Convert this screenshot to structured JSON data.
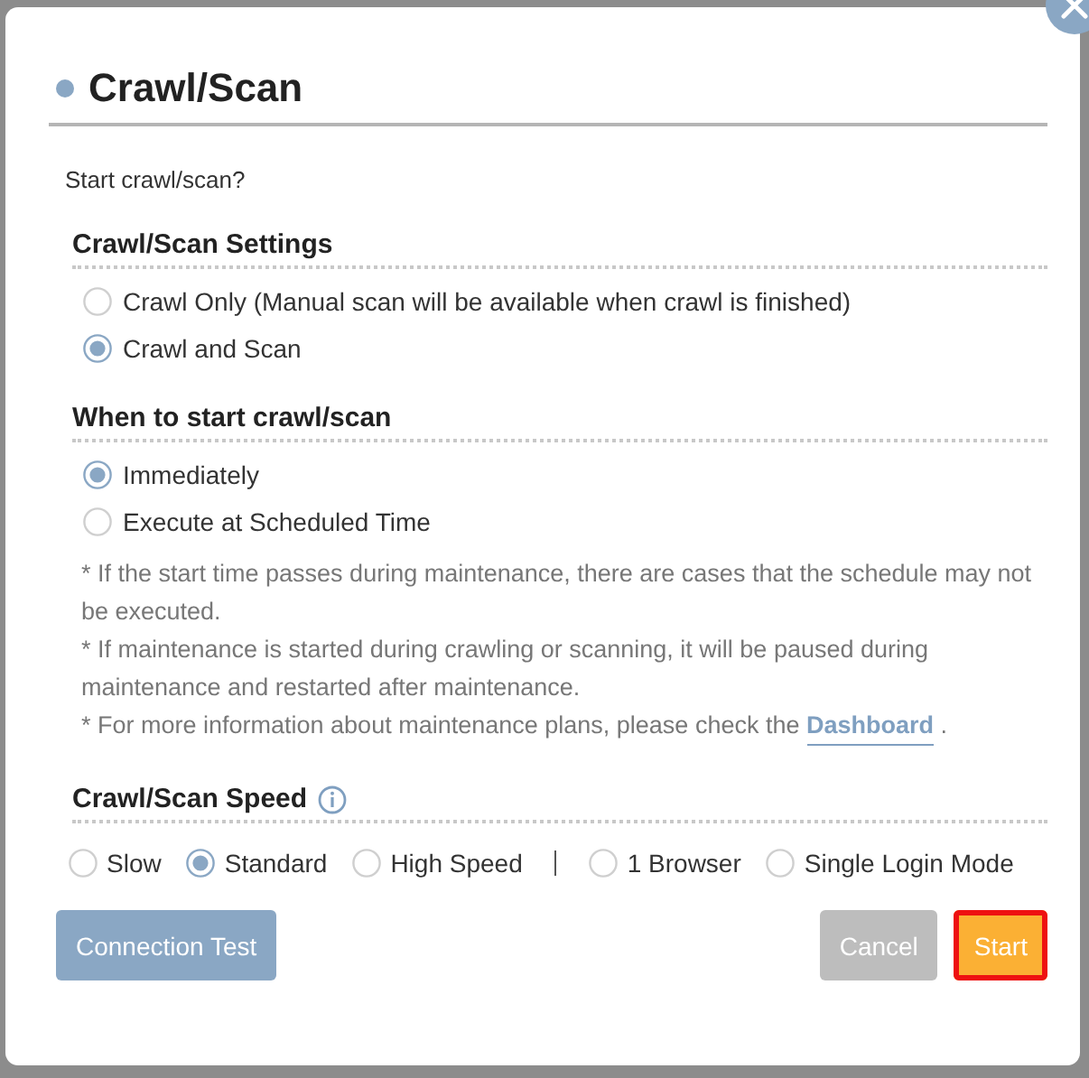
{
  "dialog": {
    "title": "Crawl/Scan",
    "prompt": "Start crawl/scan?",
    "settings": {
      "heading": "Crawl/Scan Settings",
      "options": [
        {
          "label": "Crawl Only (Manual scan will be available when crawl is finished)",
          "selected": false
        },
        {
          "label": "Crawl and Scan",
          "selected": true
        }
      ]
    },
    "timing": {
      "heading": "When to start crawl/scan",
      "options": [
        {
          "label": "Immediately",
          "selected": true
        },
        {
          "label": "Execute at Scheduled Time",
          "selected": false
        }
      ],
      "notes": [
        {
          "text": "* If the start time passes during maintenance, there are cases that the schedule may not be executed."
        },
        {
          "text": "* If maintenance is started during crawling or scanning, it will be paused during maintenance and restarted after maintenance."
        },
        {
          "text": "* For more information about maintenance plans, please check the",
          "link": "Dashboard",
          "suffix": "."
        }
      ]
    },
    "speed": {
      "heading": "Crawl/Scan Speed",
      "options": [
        {
          "label": "Slow",
          "selected": false
        },
        {
          "label": "Standard",
          "selected": true
        },
        {
          "label": "High Speed",
          "selected": false
        }
      ],
      "browser_options": [
        {
          "label": "1 Browser",
          "selected": false
        },
        {
          "label": "Single Login Mode",
          "selected": false
        }
      ]
    },
    "buttons": [
      {
        "label": "Connection Test",
        "kind": "secondary",
        "focused": false
      },
      {
        "label": "Cancel",
        "kind": "cancel",
        "focused": false
      },
      {
        "label": "Start",
        "kind": "primary",
        "focused": true
      }
    ]
  }
}
